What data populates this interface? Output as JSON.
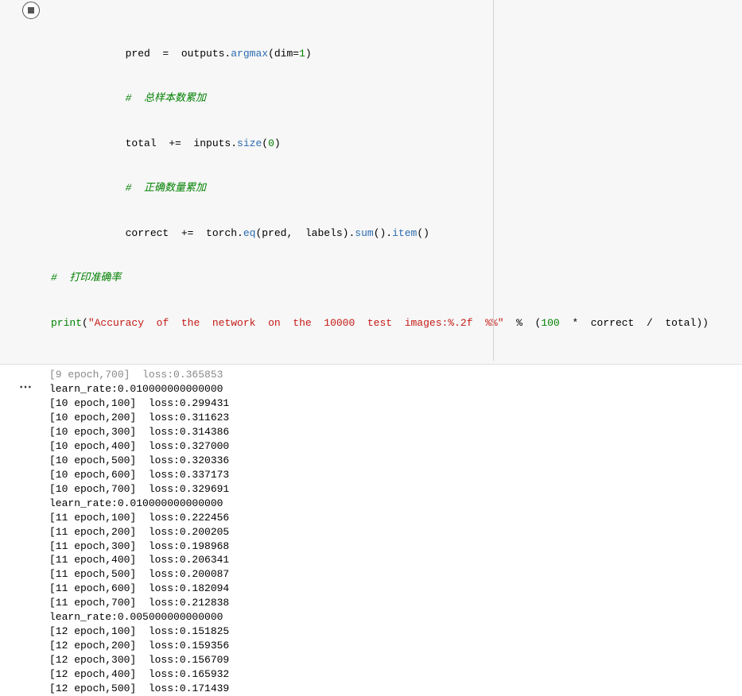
{
  "code": {
    "line1_pre": "            pred  =  outputs.",
    "line1_func": "argmax",
    "line1_post1": "(dim=",
    "line1_num": "1",
    "line1_post2": ")",
    "line2_comment": "            #  总样本数累加",
    "line3_pre": "            total  +=  inputs.",
    "line3_func": "size",
    "line3_post1": "(",
    "line3_num": "0",
    "line3_post2": ")",
    "line4_comment": "            #  正确数量累加",
    "line5_pre": "            correct  +=  torch.",
    "line5_func1": "eq",
    "line5_mid1": "(pred,  labels).",
    "line5_func2": "sum",
    "line5_mid2": "().",
    "line5_func3": "item",
    "line5_post": "()",
    "line6_comment": "#  打印准确率",
    "line7_print": "print",
    "line7_open": "(",
    "line7_str": "\"Accuracy  of  the  network  on  the  10000  test  images:%.2f  %%\"",
    "line7_mid": "  %  (",
    "line7_num": "100",
    "line7_post": "  *  correct  /  total))"
  },
  "output_lines": [
    "[9 epoch,700]  loss:0.365853",
    "learn_rate:0.010000000000000",
    "[10 epoch,100]  loss:0.299431",
    "[10 epoch,200]  loss:0.311623",
    "[10 epoch,300]  loss:0.314386",
    "[10 epoch,400]  loss:0.327000",
    "[10 epoch,500]  loss:0.320336",
    "[10 epoch,600]  loss:0.337173",
    "[10 epoch,700]  loss:0.329691",
    "learn_rate:0.010000000000000",
    "[11 epoch,100]  loss:0.222456",
    "[11 epoch,200]  loss:0.200205",
    "[11 epoch,300]  loss:0.198968",
    "[11 epoch,400]  loss:0.206341",
    "[11 epoch,500]  loss:0.200087",
    "[11 epoch,600]  loss:0.182094",
    "[11 epoch,700]  loss:0.212838",
    "learn_rate:0.005000000000000",
    "[12 epoch,100]  loss:0.151825",
    "[12 epoch,200]  loss:0.159356",
    "[12 epoch,300]  loss:0.156709",
    "[12 epoch,400]  loss:0.165932",
    "[12 epoch,500]  loss:0.171439"
  ]
}
